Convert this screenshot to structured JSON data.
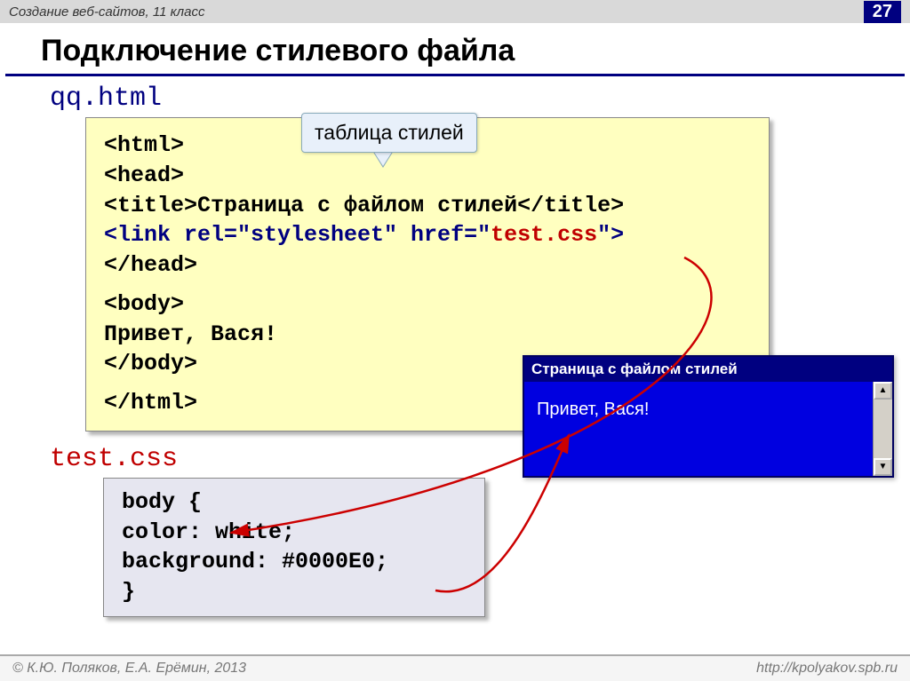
{
  "header": {
    "course": "Создание веб-сайтов, 11 класс",
    "page_number": "27"
  },
  "title": "Подключение стилевого файла",
  "filenames": {
    "html": "qq.html",
    "css": "test.css"
  },
  "callout": "таблица стилей",
  "html_code": {
    "l1": "<html>",
    "l2": "<head>",
    "l3a": "<title>",
    "l3b": "Страница с файлом стилей",
    "l3c": "</title>",
    "l4a": "<link rel=\"stylesheet\" href=\"",
    "l4b": "test.css",
    "l4c": "\">",
    "l5": "</head>",
    "l6": "<body>",
    "l7": "Привет, Вася!",
    "l8": "</body>",
    "l9": "</html>"
  },
  "css_code": {
    "l1": "body {",
    "l2": "  color: white;",
    "l3": "  background: #0000E0;",
    "l4": "}"
  },
  "browser": {
    "title": "Страница с файлом стилей",
    "body": "Привет, Вася!"
  },
  "scroll": {
    "up": "▲",
    "down": "▼"
  },
  "footer": {
    "copyright": "© К.Ю. Поляков, Е.А. Ерёмин, 2013",
    "url": "http://kpolyakov.spb.ru"
  }
}
